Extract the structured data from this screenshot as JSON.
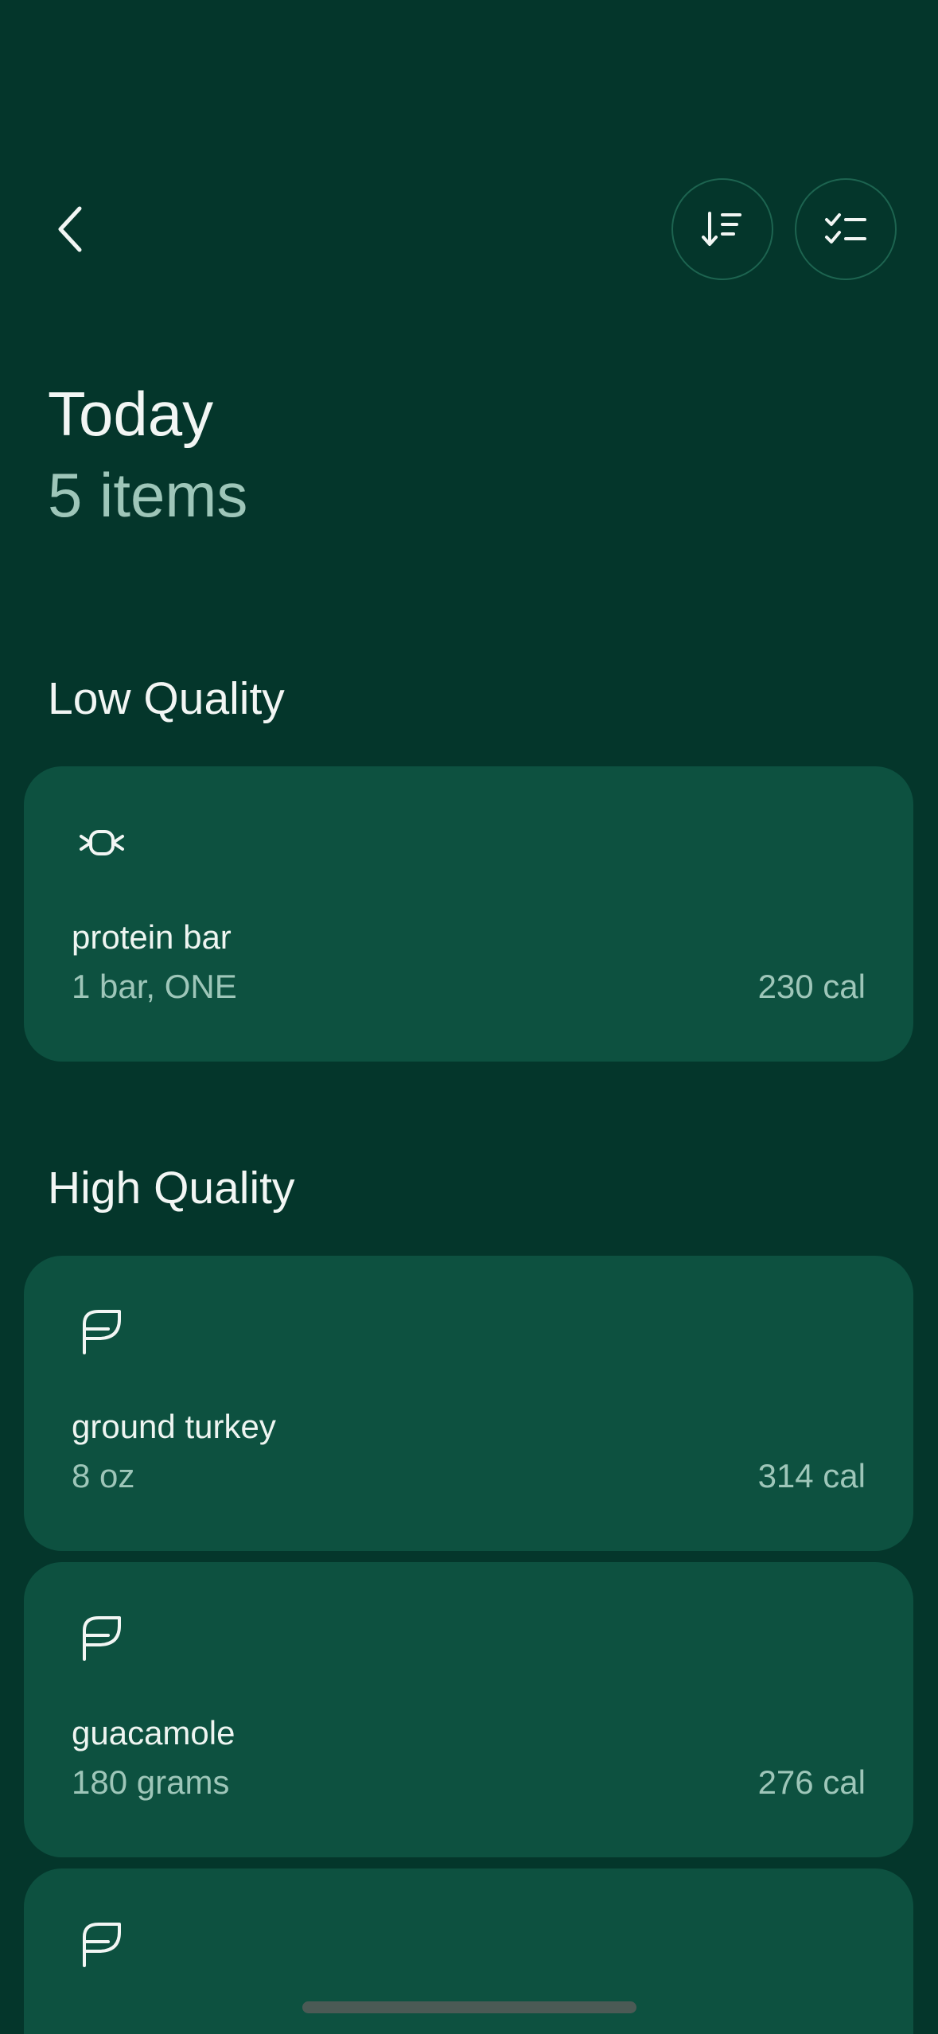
{
  "header": {
    "back_icon": "chevron-left-icon",
    "sort_icon": "sort-descending-icon",
    "select_icon": "checklist-icon"
  },
  "page": {
    "title": "Today",
    "subtitle": "5 items"
  },
  "sections": [
    {
      "heading": "Low Quality",
      "items": [
        {
          "icon": "candy-icon",
          "name": "protein bar",
          "serving": "1 bar, ONE",
          "calories": "230 cal"
        }
      ]
    },
    {
      "heading": "High Quality",
      "items": [
        {
          "icon": "leaf-icon",
          "name": "ground turkey",
          "serving": "8 oz",
          "calories": "314 cal"
        },
        {
          "icon": "leaf-icon",
          "name": "guacamole",
          "serving": "180 grams",
          "calories": "276 cal"
        },
        {
          "icon": "leaf-icon"
        }
      ]
    }
  ],
  "colors": {
    "background": "#04362b",
    "card": "#0d5140",
    "text_primary": "#f2f6f4",
    "text_secondary": "#9ec6b9",
    "button_border": "#1d6450"
  }
}
